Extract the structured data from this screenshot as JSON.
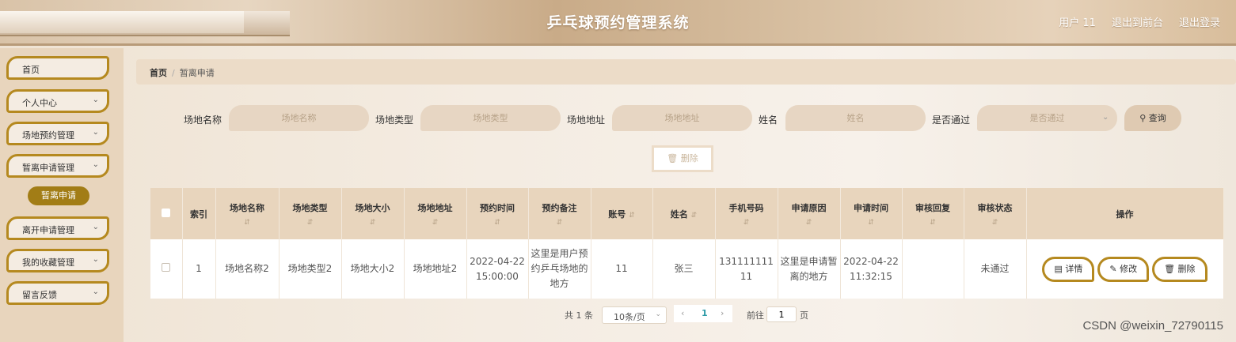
{
  "header": {
    "title": "乒乓球预约管理系统",
    "user": "用户 11",
    "frontend_link": "退出到前台",
    "logout_link": "退出登录"
  },
  "sidebar": {
    "items": [
      {
        "label": "首页"
      },
      {
        "label": "个人中心"
      },
      {
        "label": "场地预约管理"
      },
      {
        "label": "暂离申请管理"
      },
      {
        "label": "离开申请管理"
      },
      {
        "label": "我的收藏管理"
      },
      {
        "label": "留言反馈"
      }
    ],
    "active_sub": "暂离申请"
  },
  "breadcrumb": {
    "home": "首页",
    "sep": "/",
    "current": "暂离申请"
  },
  "search": {
    "venue_name_label": "场地名称",
    "venue_name_placeholder": "场地名称",
    "venue_type_label": "场地类型",
    "venue_type_placeholder": "场地类型",
    "venue_addr_label": "场地地址",
    "venue_addr_placeholder": "场地地址",
    "name_label": "姓名",
    "name_placeholder": "姓名",
    "passed_label": "是否通过",
    "passed_placeholder": "是否通过",
    "query_btn": "查询"
  },
  "bulk_delete": "删除",
  "table": {
    "headers": [
      "索引",
      "场地名称",
      "场地类型",
      "场地大小",
      "场地地址",
      "预约时间",
      "预约备注",
      "账号",
      "姓名",
      "手机号码",
      "申请原因",
      "申请时间",
      "审核回复",
      "审核状态",
      "操作"
    ],
    "rows": [
      {
        "index": "1",
        "venue_name": "场地名称2",
        "venue_type": "场地类型2",
        "venue_size": "场地大小2",
        "venue_addr": "场地地址2",
        "book_time": "2022-04-22 15:00:00",
        "book_note": "这里是用户预约乒乓场地的地方",
        "account": "11",
        "name": "张三",
        "phone": "13111111111",
        "reason": "这里是申请暂离的地方",
        "apply_time": "2022-04-22 11:32:15",
        "reply": "",
        "status": "未通过",
        "actions": {
          "detail": "详情",
          "edit": "修改",
          "delete": "删除"
        }
      }
    ]
  },
  "pagination": {
    "total": "共 1 条",
    "page_size": "10条/页",
    "current_page": "1",
    "goto": "前往",
    "jump_value": "1",
    "unit": "页"
  },
  "watermark": "CSDN @weixin_72790115",
  "colors": {
    "accent": "#b5891f",
    "sub_active": "#a27d16",
    "table_head": "#e8d5bd"
  }
}
